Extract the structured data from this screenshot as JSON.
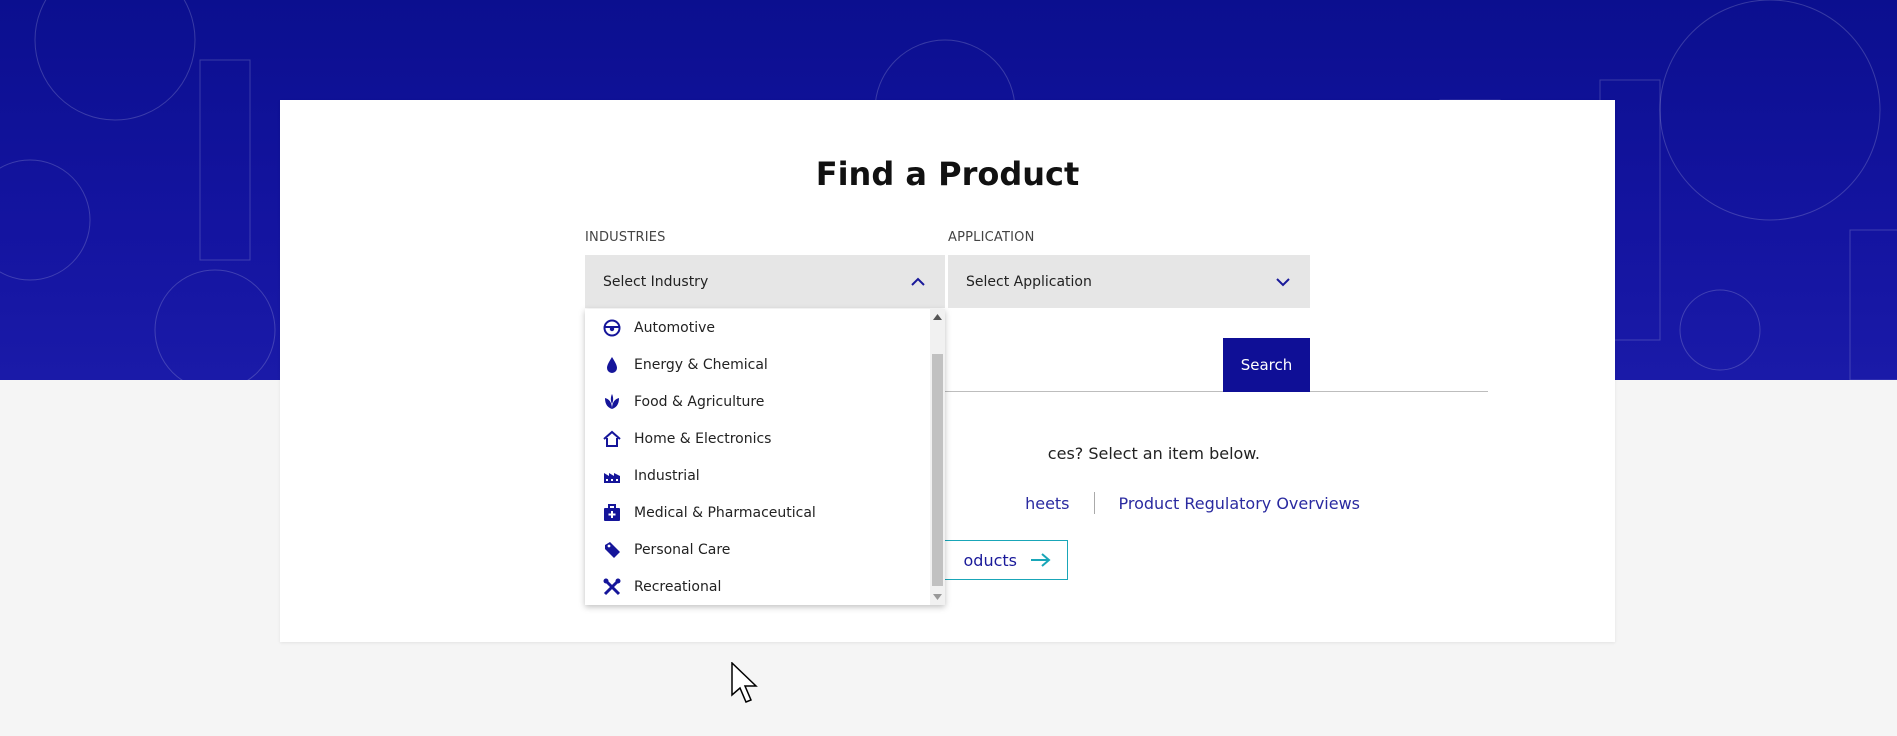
{
  "page": {
    "title": "Find a Product"
  },
  "industries": {
    "label": "INDUSTRIES",
    "selected": "Select Industry",
    "expanded": true,
    "options": [
      {
        "label": "Automotive",
        "icon": "steering-wheel-icon"
      },
      {
        "label": "Energy & Chemical",
        "icon": "droplet-icon"
      },
      {
        "label": "Food & Agriculture",
        "icon": "leaf-icon"
      },
      {
        "label": "Home & Electronics",
        "icon": "house-icon"
      },
      {
        "label": "Industrial",
        "icon": "factory-icon"
      },
      {
        "label": "Medical & Pharmaceutical",
        "icon": "medical-kit-icon"
      },
      {
        "label": "Personal Care",
        "icon": "tag-icon"
      },
      {
        "label": "Recreational",
        "icon": "crossed-tools-icon"
      }
    ]
  },
  "application": {
    "label": "APPLICATION",
    "selected": "Select Application"
  },
  "search": {
    "button_label": "Search"
  },
  "resources": {
    "hint_text": "ces? Select an item below.",
    "links": [
      "heets",
      "Product Regulatory Overviews"
    ],
    "all_products_label": "oducts"
  },
  "colors": {
    "brand_blue": "#0f0f96",
    "link_blue": "#2a2aa0",
    "outline_teal": "#19a6b8"
  }
}
